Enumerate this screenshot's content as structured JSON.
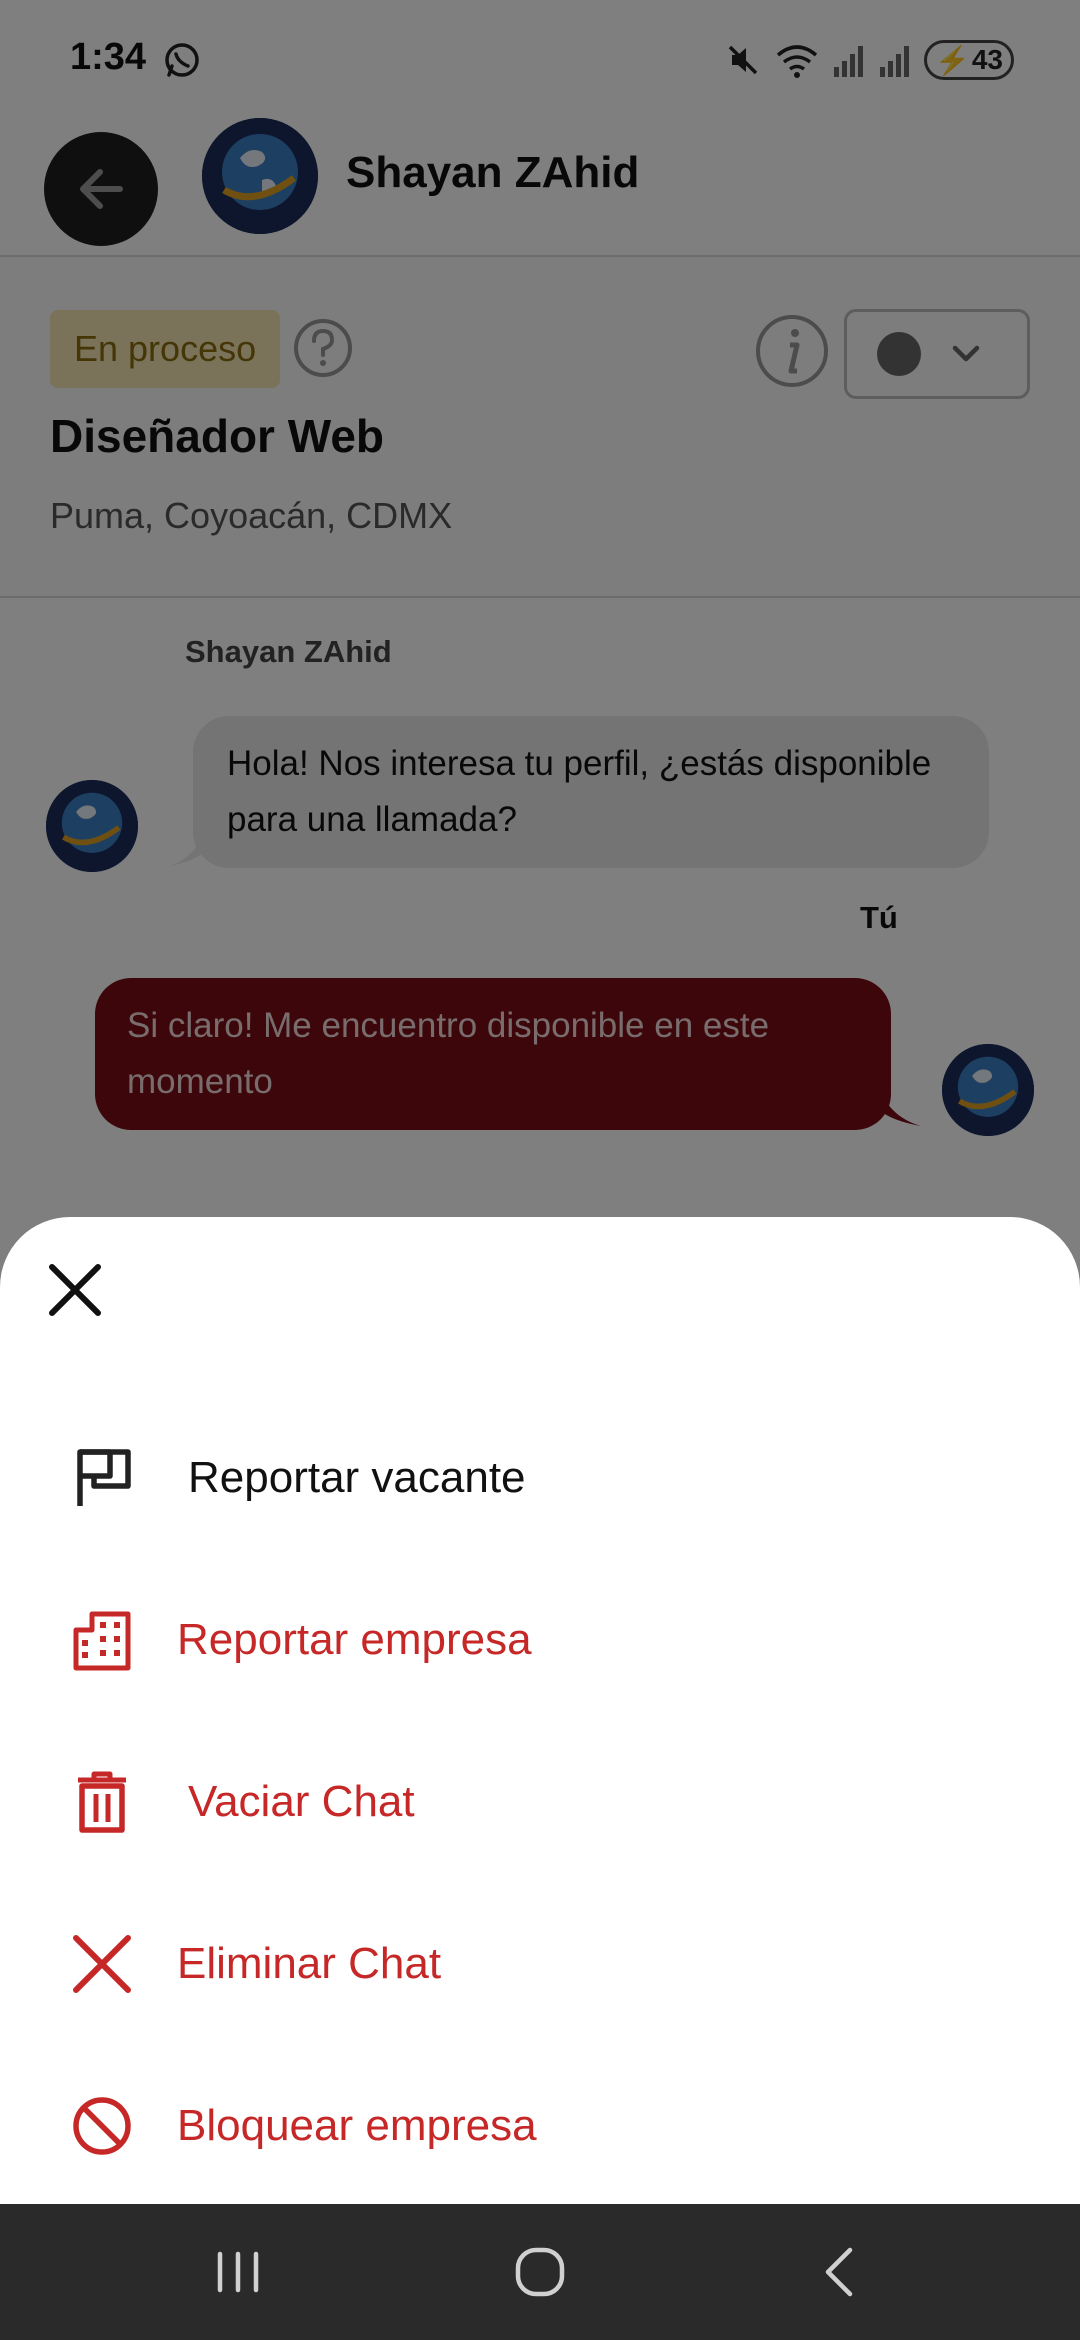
{
  "status_bar": {
    "time": "1:34",
    "battery": "43",
    "whatsapp_icon": "whatsapp-icon",
    "mute_icon": "mute-icon",
    "wifi_icon": "wifi-icon",
    "signal_icon": "signal-icon"
  },
  "header": {
    "contact_name": "Shayan ZAhid",
    "back_icon": "arrow-left-icon"
  },
  "job": {
    "status": "En proceso",
    "title": "Diseñador Web",
    "location": "Puma, Coyoacán, CDMX"
  },
  "chat": {
    "incoming_sender": "Shayan ZAhid",
    "incoming_text": "Hola! Nos interesa tu perfil, ¿estás disponible para una llamada?",
    "you_label": "Tú",
    "outgoing_text": "Si claro! Me encuentro disponible en este momento"
  },
  "sheet": {
    "close_icon": "close-icon",
    "options": [
      {
        "label": "Reportar vacante",
        "icon": "flag-icon",
        "color": "#111111"
      },
      {
        "label": "Reportar empresa",
        "icon": "building-icon",
        "color": "#c62828"
      },
      {
        "label": "Vaciar Chat",
        "icon": "trash-icon",
        "color": "#c62828"
      },
      {
        "label": "Eliminar Chat",
        "icon": "x-icon",
        "color": "#c62828"
      },
      {
        "label": "Bloquear empresa",
        "icon": "block-icon",
        "color": "#c62828"
      }
    ]
  },
  "colors": {
    "accent": "#c62828",
    "outgoing_bubble": "#7a0c14",
    "badge_bg": "#f4e6b2"
  }
}
